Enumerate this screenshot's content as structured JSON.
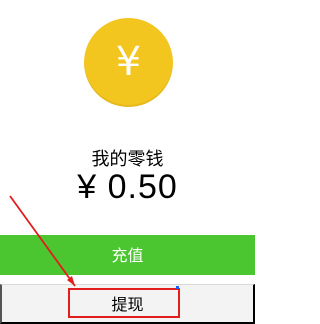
{
  "wallet": {
    "coin_symbol": "¥",
    "title": "我的零钱",
    "balance": "¥ 0.50"
  },
  "actions": {
    "recharge_label": "充值",
    "withdraw_label": "提现"
  },
  "colors": {
    "coin": "#f2c51f",
    "recharge_bg": "#4bc630",
    "annotation": "#e11d1d"
  },
  "icons": {
    "coin": "yuan-coin-icon"
  }
}
